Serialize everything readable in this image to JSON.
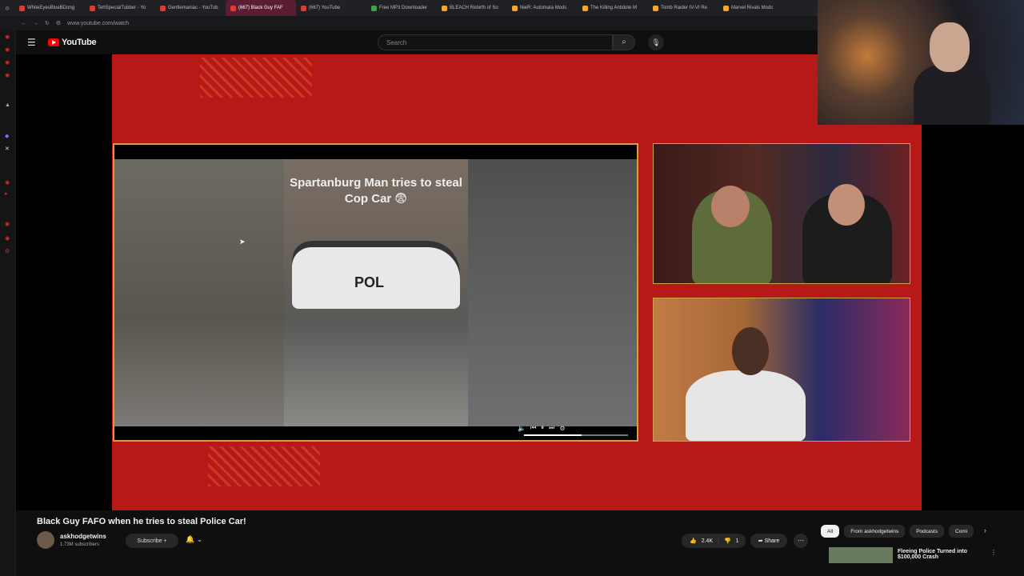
{
  "browser": {
    "tabs": [
      {
        "label": "WhiteEyesBlueBDong",
        "color": "#e53935"
      },
      {
        "label": "TehSpecialTubber - Yo",
        "color": "#e53935"
      },
      {
        "label": "Gentlemaniac - YouTub",
        "color": "#e53935"
      },
      {
        "label": "(667) Black Guy FAF",
        "color": "#e53935",
        "active": true
      },
      {
        "label": "(667) YouTube",
        "color": "#e53935"
      },
      {
        "label": "Free MP3 Downloader",
        "color": "#43a047"
      },
      {
        "label": "BLEACH Rebirth of So",
        "color": "#f9a825"
      },
      {
        "label": "NieR: Automata Mods",
        "color": "#f9a825"
      },
      {
        "label": "The Killing Antidote M",
        "color": "#f9a825"
      },
      {
        "label": "Tomb Raider IV-VI Re",
        "color": "#f9a825"
      },
      {
        "label": "Marvel Rivals Mods",
        "color": "#f9a825"
      }
    ],
    "url": "www.youtube.com/watch"
  },
  "youtube": {
    "logo": "YouTube",
    "search_placeholder": "Search"
  },
  "video": {
    "overlay_title": "Spartanburg Man tries to steal Cop Car 😨",
    "car_text": "POL",
    "progress": 0.55
  },
  "info": {
    "title": "Black Guy FAFO when he tries to steal Police Car!",
    "channel": "askhodgetwins",
    "subscribers": "1.73M subscribers",
    "subscribe_label": "Subscribe",
    "likes": "2.4K",
    "dislikes": "1",
    "share_label": "Share"
  },
  "sidebar_chips": [
    "All",
    "From askhodgetwins",
    "Podcasts",
    "Comi"
  ],
  "recommendation": {
    "title": "Fleeing Police Turned into $100,000 Crash"
  },
  "colors": {
    "accent_red": "#b71818",
    "frame_gold": "#c9a34a",
    "yt_red": "#ff0000"
  }
}
